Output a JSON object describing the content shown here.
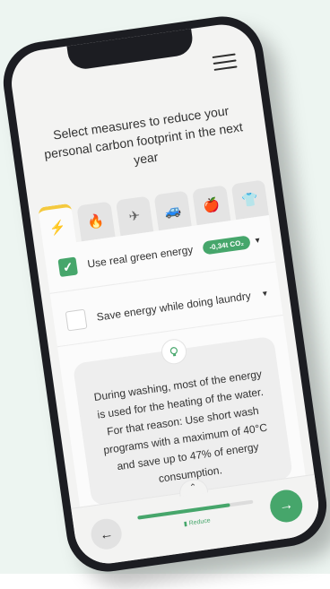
{
  "header": {
    "title": "Select measures to reduce your personal carbon footprint in the next year"
  },
  "tabs": [
    {
      "icon": "lightning-icon",
      "glyph": "⚡",
      "active": true
    },
    {
      "icon": "fire-icon",
      "glyph": "🔥",
      "active": false
    },
    {
      "icon": "airplane-icon",
      "glyph": "✈",
      "active": false
    },
    {
      "icon": "car-icon",
      "glyph": "🚙",
      "active": false
    },
    {
      "icon": "apple-icon",
      "glyph": "🍎",
      "active": false
    },
    {
      "icon": "shirt-icon",
      "glyph": "👕",
      "active": false
    }
  ],
  "measures": [
    {
      "label": "Use real green energy",
      "checked": true,
      "badge": "-0,34t CO₂"
    },
    {
      "label": "Save energy while doing laundry",
      "checked": false
    }
  ],
  "info": {
    "icon": "lightbulb-icon",
    "text": "During washing, most of the energy is used for the heating of the water. For that reason: Use short wash programs with a maximum of 40°C and save up to 47% of energy consumption."
  },
  "footer": {
    "stage_label": "Reduce",
    "progress": 0.8
  },
  "colors": {
    "accent": "#46a66b",
    "tab_highlight": "#f4c93e"
  }
}
